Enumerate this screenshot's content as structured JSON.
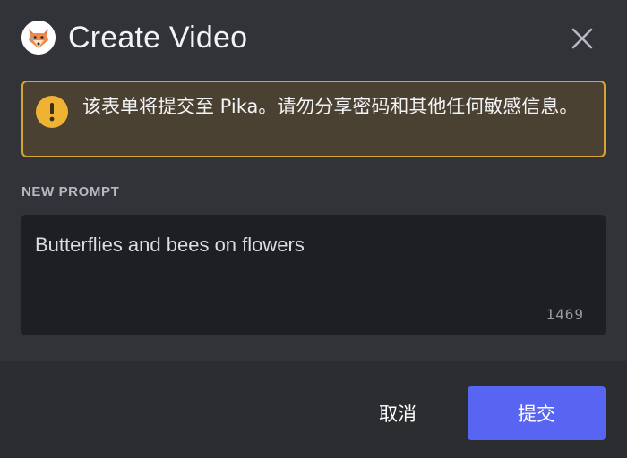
{
  "dialog": {
    "title": "Create Video",
    "app_icon": "pika-fox-avatar-icon",
    "close_icon": "close-icon"
  },
  "warning": {
    "icon": "exclamation-icon",
    "message": "该表单将提交至 Pika。请勿分享密码和其他任何敏感信息。"
  },
  "prompt": {
    "label": "NEW PROMPT",
    "value": "Butterflies and bees on flowers",
    "remaining_chars": "1469"
  },
  "footer": {
    "cancel_label": "取消",
    "submit_label": "提交"
  },
  "colors": {
    "background": "#313338",
    "footer": "#2b2d31",
    "input": "#1e1f22",
    "warning_border": "#d4a533",
    "warning_icon": "#f0b232",
    "primary_button": "#5865f2"
  }
}
